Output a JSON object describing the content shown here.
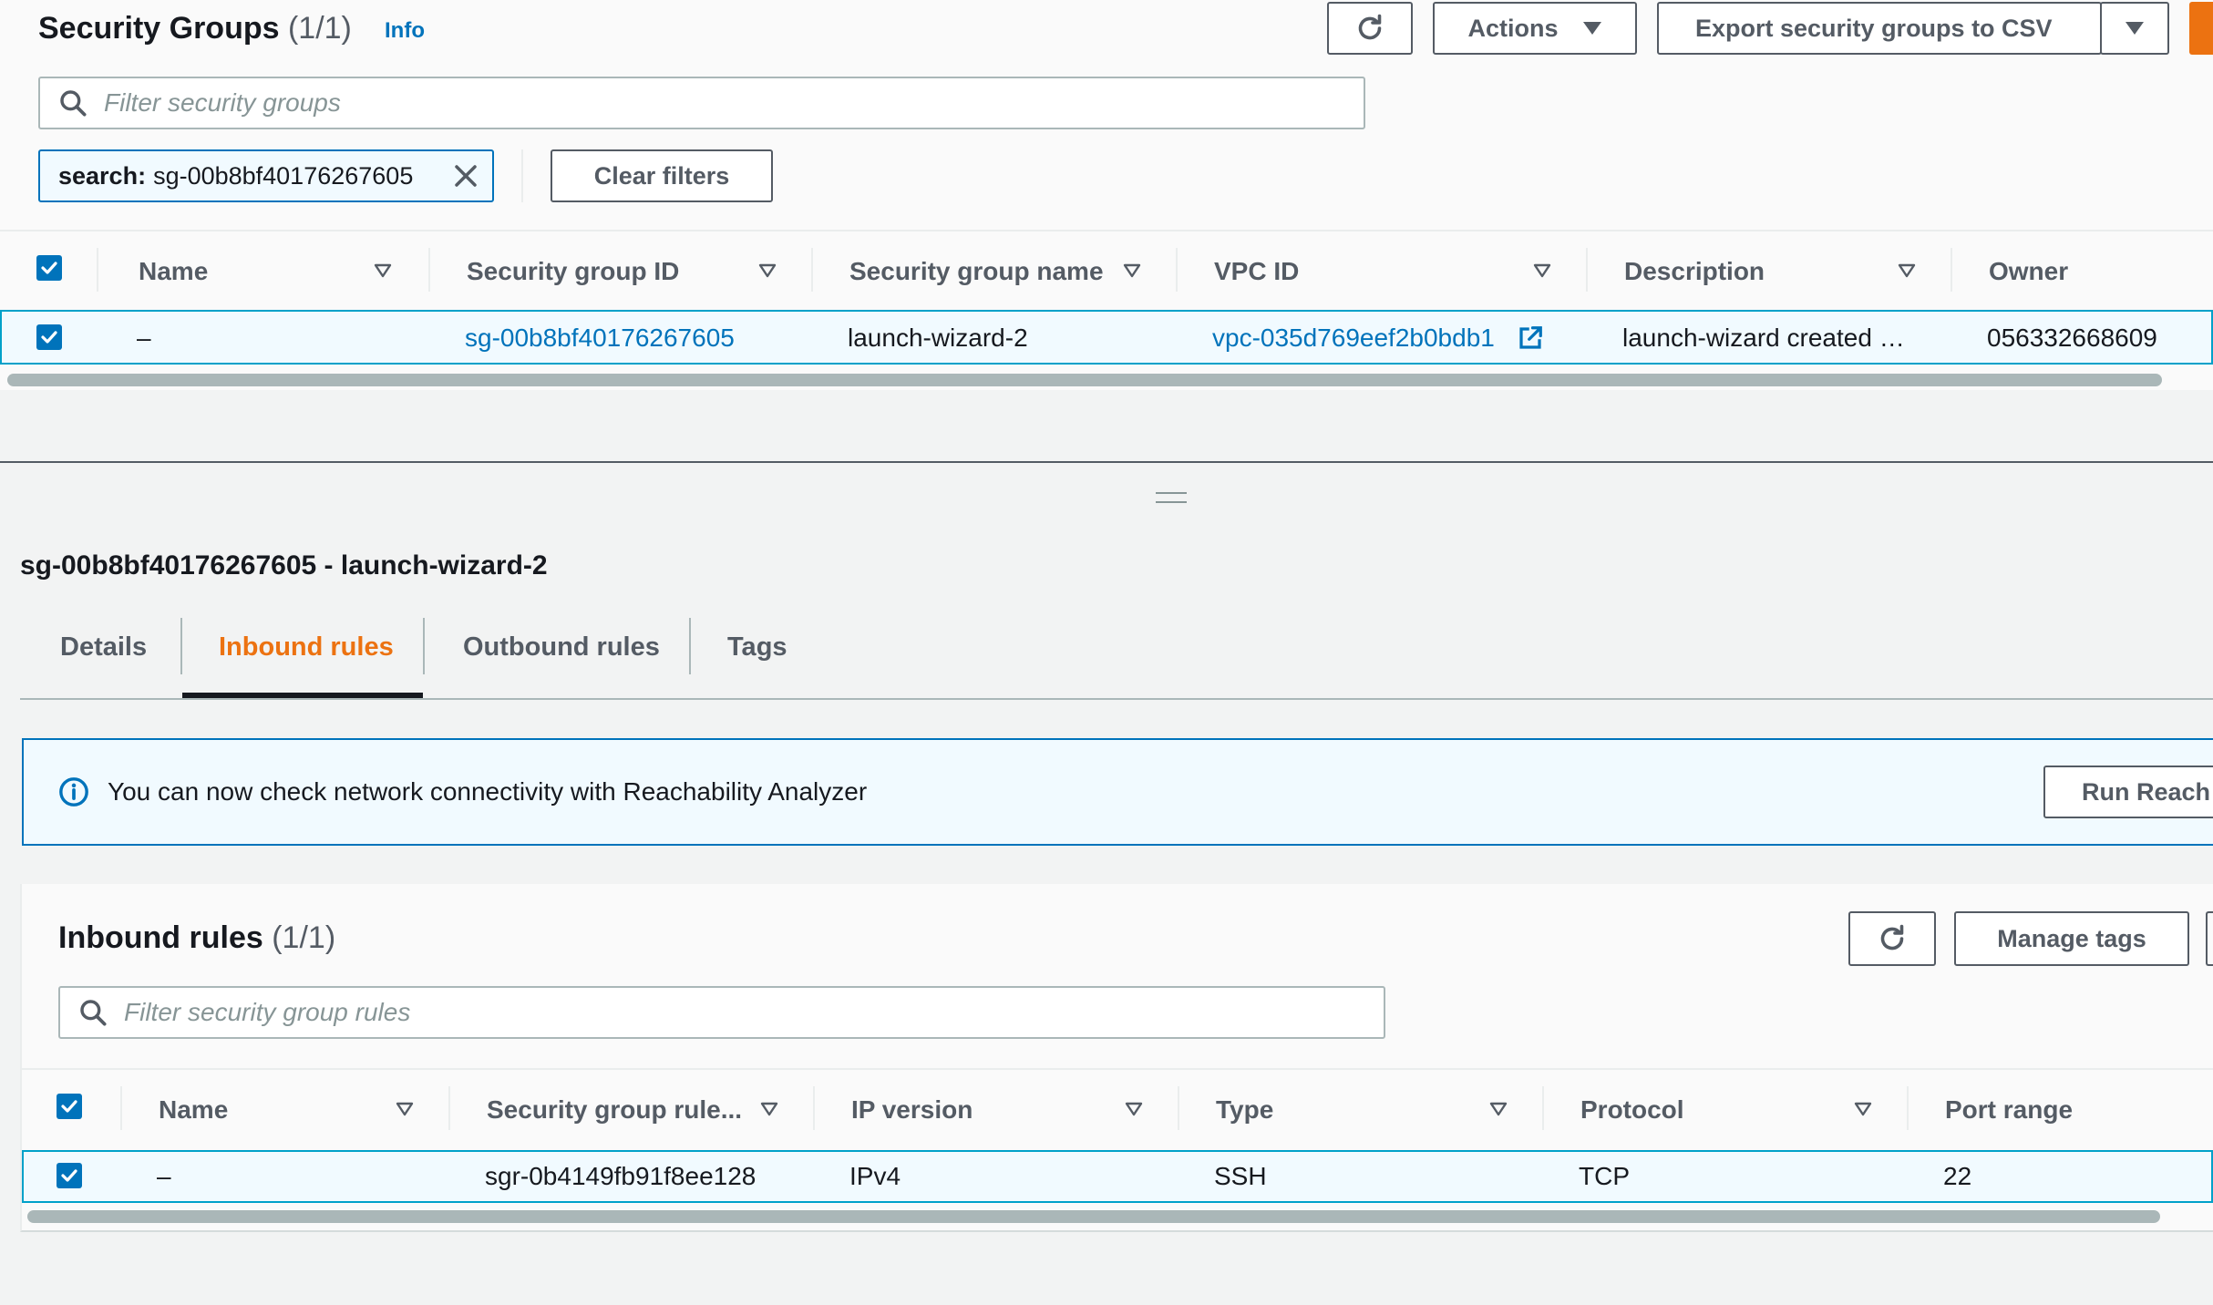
{
  "security_groups": {
    "title": "Security Groups",
    "count": "(1/1)",
    "info_label": "Info",
    "refresh_icon": "refresh-icon",
    "actions_label": "Actions",
    "export_label": "Export security groups to CSV",
    "search_placeholder": "Filter security groups",
    "filter_token_key": "search:",
    "filter_token_value": "sg-00b8bf40176267605",
    "clear_filters_label": "Clear filters",
    "columns": [
      "Name",
      "Security group ID",
      "Security group name",
      "VPC ID",
      "Description",
      "Owner"
    ],
    "rows": [
      {
        "name": "–",
        "security_group_id": "sg-00b8bf40176267605",
        "security_group_name": "launch-wizard-2",
        "vpc_id": "vpc-035d769eef2b0bdb1",
        "description": "launch-wizard created …",
        "owner": "056332668609"
      }
    ]
  },
  "detail": {
    "title": "sg-00b8bf40176267605 - launch-wizard-2",
    "tabs": [
      {
        "label": "Details",
        "active": false
      },
      {
        "label": "Inbound rules",
        "active": true
      },
      {
        "label": "Outbound rules",
        "active": false
      },
      {
        "label": "Tags",
        "active": false
      }
    ],
    "banner_text": "You can now check network connectivity with Reachability Analyzer",
    "banner_button": "Run Reach"
  },
  "inbound_rules": {
    "title": "Inbound rules",
    "count": "(1/1)",
    "manage_tags_label": "Manage tags",
    "search_placeholder": "Filter security group rules",
    "columns": [
      "Name",
      "Security group rule...",
      "IP version",
      "Type",
      "Protocol",
      "Port range"
    ],
    "rows": [
      {
        "name": "–",
        "rule_id": "sgr-0b4149fb91f8ee128",
        "ip_version": "IPv4",
        "type": "SSH",
        "protocol": "TCP",
        "port_range": "22"
      }
    ]
  },
  "colors": {
    "accent": "#0073bb",
    "active_tab": "#ec7211",
    "primary_button": "#ec7211"
  }
}
